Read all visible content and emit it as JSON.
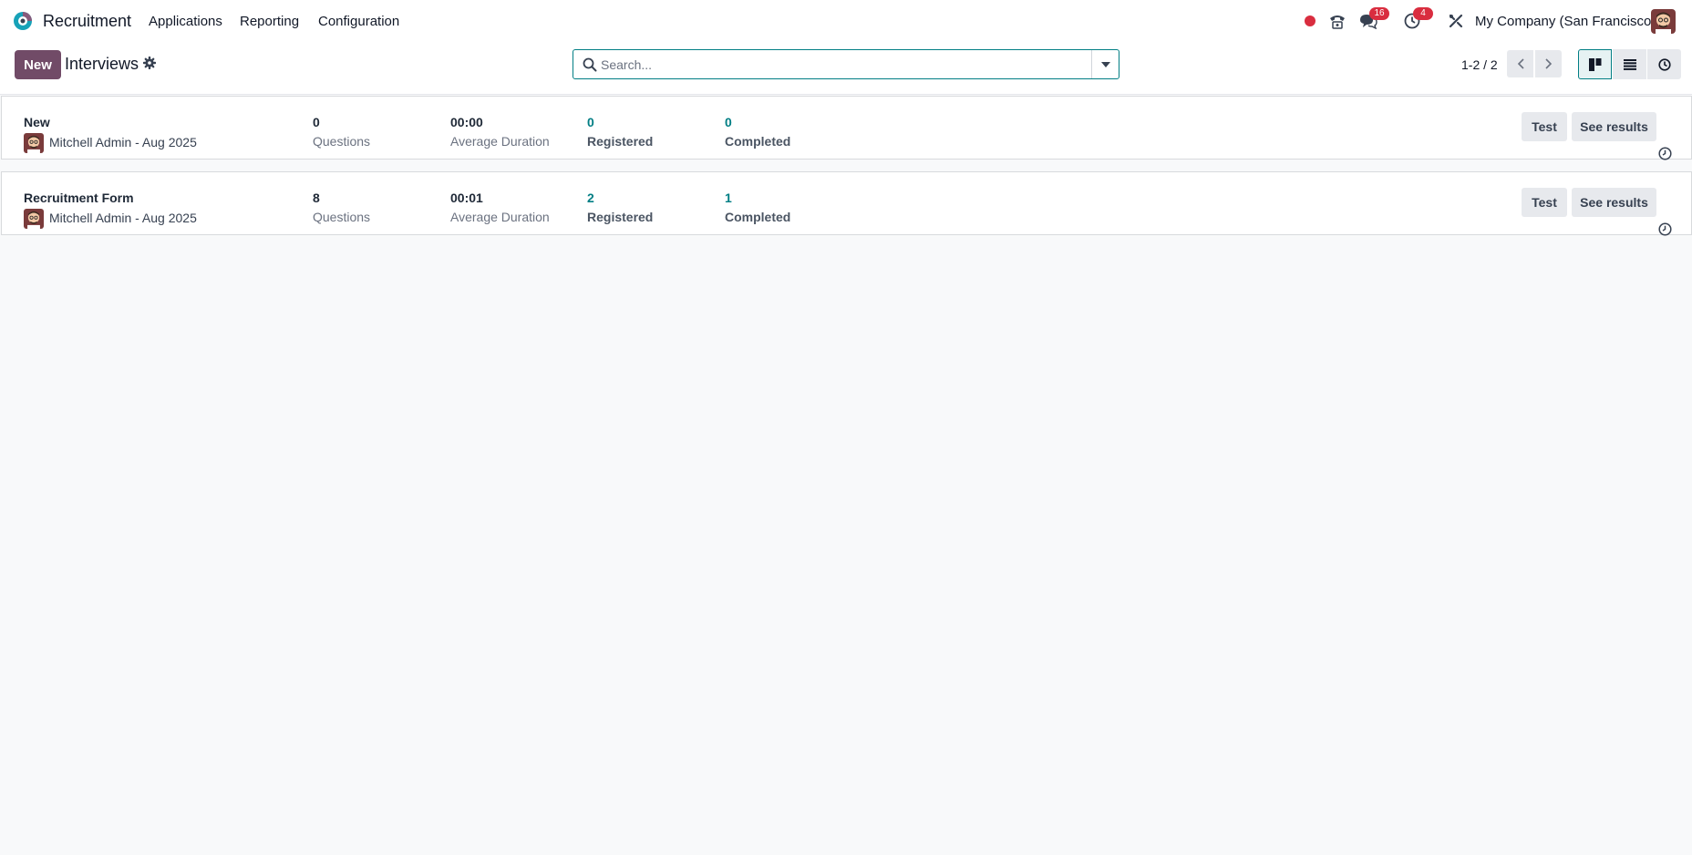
{
  "navbar": {
    "app_name": "Recruitment",
    "menu": [
      "Applications",
      "Reporting",
      "Configuration"
    ],
    "messages_count": "16",
    "activities_count": "4",
    "company": "My Company (San Francisco)",
    "brand_color": "#714b67",
    "accent_color": "#017e84"
  },
  "control_panel": {
    "new_label": "New",
    "title": "Interviews",
    "search_placeholder": "Search...",
    "pager": "1-2 / 2",
    "active_view": "kanban"
  },
  "records": [
    {
      "title": "New",
      "owner": "Mitchell Admin - Aug 2025",
      "questions": "0",
      "questions_label": "Questions",
      "duration": "00:00",
      "duration_label": "Average Duration",
      "registered": "0",
      "registered_label": "Registered",
      "completed": "0",
      "completed_label": "Completed",
      "test_label": "Test",
      "results_label": "See results"
    },
    {
      "title": "Recruitment Form",
      "owner": "Mitchell Admin - Aug 2025",
      "questions": "8",
      "questions_label": "Questions",
      "duration": "00:01",
      "duration_label": "Average Duration",
      "registered": "2",
      "registered_label": "Registered",
      "completed": "1",
      "completed_label": "Completed",
      "test_label": "Test",
      "results_label": "See results"
    }
  ]
}
